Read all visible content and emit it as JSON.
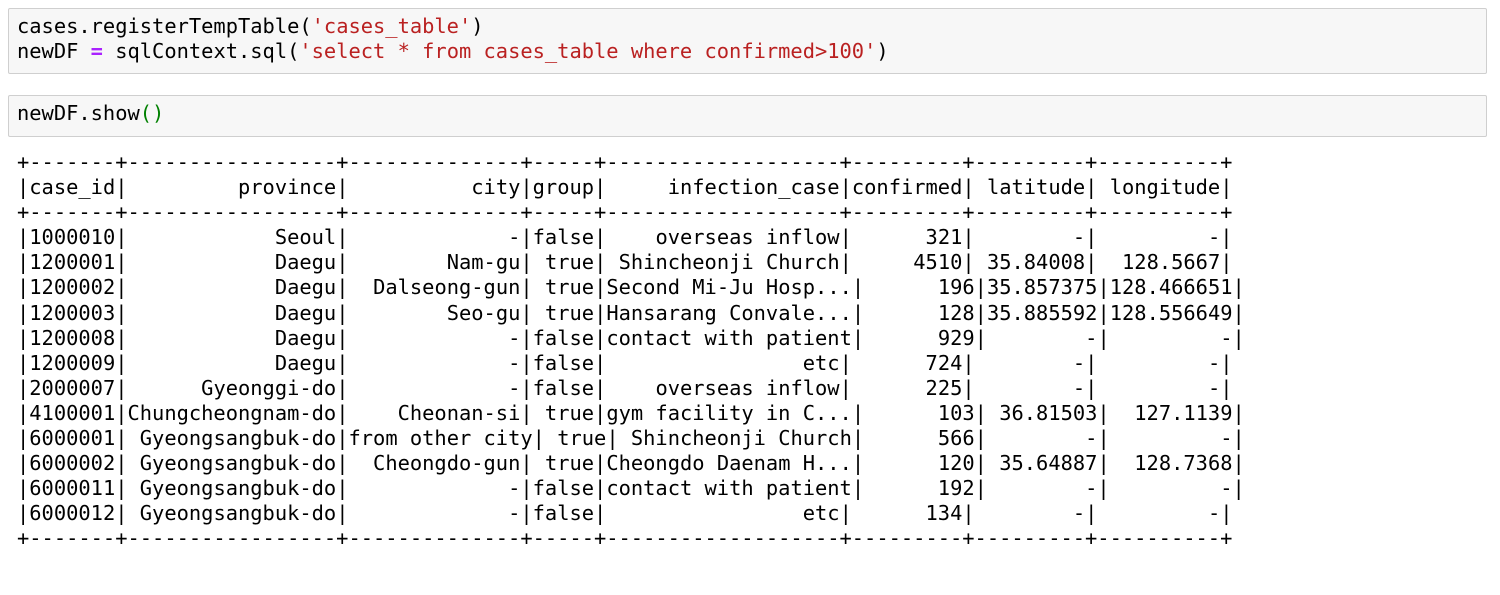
{
  "cells": [
    {
      "type": "code",
      "lines": [
        {
          "segments": [
            {
              "text": "cases.registerTempTable(",
              "kind": "plain"
            },
            {
              "text": "'cases_table'",
              "kind": "str"
            },
            {
              "text": ")",
              "kind": "plain"
            }
          ]
        },
        {
          "segments": [
            {
              "text": "newDF ",
              "kind": "plain"
            },
            {
              "text": "=",
              "kind": "op"
            },
            {
              "text": " sqlContext.sql(",
              "kind": "plain"
            },
            {
              "text": "'select * from cases_table where confirmed>100'",
              "kind": "str"
            },
            {
              "text": ")",
              "kind": "plain"
            }
          ]
        }
      ]
    },
    {
      "type": "code",
      "lines": [
        {
          "segments": [
            {
              "text": "newDF.show",
              "kind": "plain"
            },
            {
              "text": "()",
              "kind": "paren"
            }
          ]
        }
      ]
    }
  ],
  "colors": {
    "string": "#ba2121",
    "operator": "#aa22ff",
    "paren": "#008000",
    "cell_background": "#f7f7f7",
    "cell_border": "#cfcfcf"
  },
  "output_table": {
    "columns": [
      "case_id",
      "province",
      "city",
      "group",
      "infection_case",
      "confirmed",
      "latitude",
      "longitude"
    ],
    "widths": [
      7,
      17,
      14,
      5,
      19,
      9,
      9,
      10
    ],
    "rows": [
      [
        "1000010",
        "Seoul",
        "-",
        "false",
        "overseas inflow",
        "321",
        "-",
        "-"
      ],
      [
        "1200001",
        "Daegu",
        "Nam-gu",
        "true",
        "Shincheonji Church",
        "4510",
        "35.84008",
        "128.5667"
      ],
      [
        "1200002",
        "Daegu",
        "Dalseong-gun",
        "true",
        "Second Mi-Ju Hosp...",
        "196",
        "35.857375",
        "128.466651"
      ],
      [
        "1200003",
        "Daegu",
        "Seo-gu",
        "true",
        "Hansarang Convale...",
        "128",
        "35.885592",
        "128.556649"
      ],
      [
        "1200008",
        "Daegu",
        "-",
        "false",
        "contact with patient",
        "929",
        "-",
        "-"
      ],
      [
        "1200009",
        "Daegu",
        "-",
        "false",
        "etc",
        "724",
        "-",
        "-"
      ],
      [
        "2000007",
        "Gyeonggi-do",
        "-",
        "false",
        "overseas inflow",
        "225",
        "-",
        "-"
      ],
      [
        "4100001",
        "Chungcheongnam-do",
        "Cheonan-si",
        "true",
        "gym facility in C...",
        "103",
        "36.81503",
        "127.1139"
      ],
      [
        "6000001",
        "Gyeongsangbuk-do",
        "from other city",
        "true",
        "Shincheonji Church",
        "566",
        "-",
        "-"
      ],
      [
        "6000002",
        "Gyeongsangbuk-do",
        "Cheongdo-gun",
        "true",
        "Cheongdo Daenam H...",
        "120",
        "35.64887",
        "128.7368"
      ],
      [
        "6000011",
        "Gyeongsangbuk-do",
        "-",
        "false",
        "contact with patient",
        "192",
        "-",
        "-"
      ],
      [
        "6000012",
        "Gyeongsangbuk-do",
        "-",
        "false",
        "etc",
        "134",
        "-",
        "-"
      ]
    ]
  }
}
